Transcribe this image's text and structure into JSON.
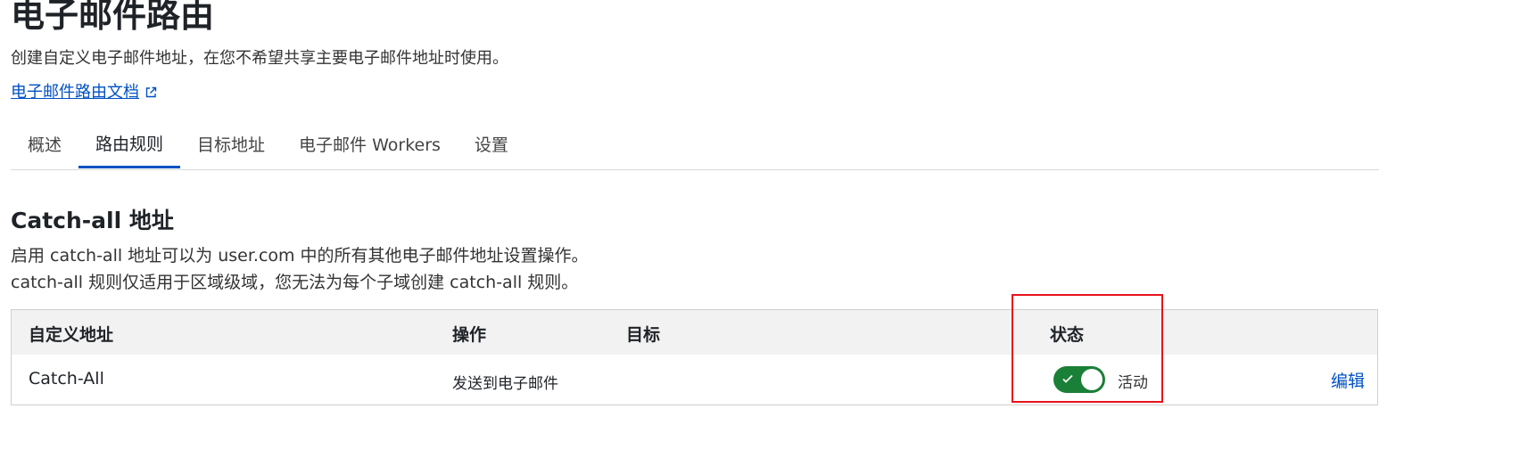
{
  "header": {
    "title": "电子邮件路由",
    "description": "创建自定义电子邮件地址，在您不希望共享主要电子邮件地址时使用。",
    "doc_link": "电子邮件路由文档"
  },
  "tabs": [
    {
      "label": "概述",
      "active": false
    },
    {
      "label": "路由规则",
      "active": true
    },
    {
      "label": "目标地址",
      "active": false
    },
    {
      "label": "电子邮件 Workers",
      "active": false
    },
    {
      "label": "设置",
      "active": false
    }
  ],
  "catch_all": {
    "title": "Catch-all 地址",
    "description_line1": "启用 catch-all 地址可以为 user.com 中的所有其他电子邮件地址设置操作。",
    "description_line2": "catch-all 规则仅适用于区域级域，您无法为每个子域创建 catch-all 规则。"
  },
  "table": {
    "headers": {
      "custom_address": "自定义地址",
      "action": "操作",
      "destination": "目标",
      "status": "状态"
    },
    "rows": [
      {
        "custom_address": "Catch-All",
        "action": "发送到电子邮件",
        "destination": "",
        "status_enabled": true,
        "status_label": "活动",
        "edit_label": "编辑"
      }
    ]
  },
  "colors": {
    "link": "#0051c3",
    "toggle_on": "#1a7f37",
    "highlight": "#e8141c"
  }
}
